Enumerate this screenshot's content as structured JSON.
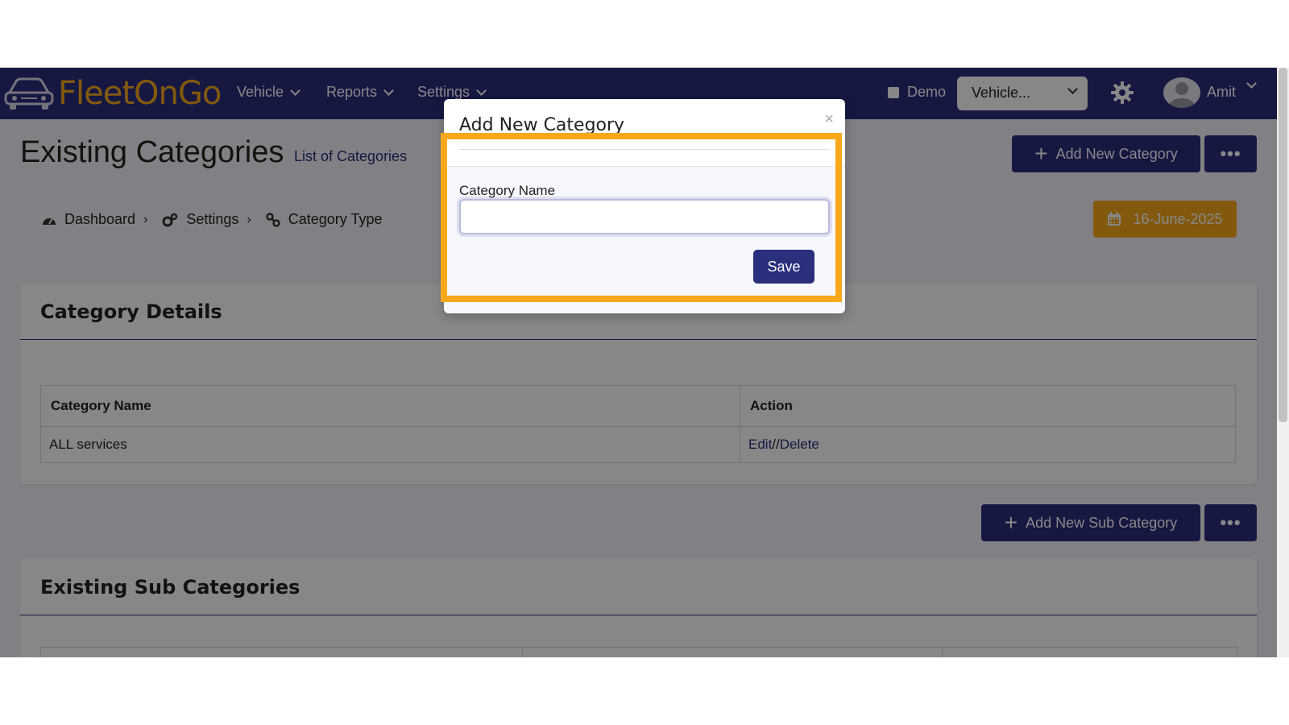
{
  "navbar": {
    "brand": "FleetOnGo",
    "brand_parts": [
      "Fleet",
      "On",
      "Go"
    ],
    "menu": [
      {
        "label": "Vehicle"
      },
      {
        "label": "Reports"
      },
      {
        "label": "Settings"
      }
    ],
    "demo_label": "Demo",
    "demo_checked": false,
    "vehicle_select": "Vehicle...",
    "user_name": "Amit"
  },
  "header": {
    "title": "Existing Categories",
    "subtitle": "List of Categories",
    "add_button": "Add New Category",
    "more_button": "•••"
  },
  "breadcrumb": {
    "items": [
      {
        "label": "Dashboard",
        "icon": "tachometer-icon"
      },
      {
        "label": "Settings",
        "icon": "cogs-icon"
      },
      {
        "label": "Category Type",
        "icon": "link-icon"
      }
    ],
    "separator": "›"
  },
  "date_button": "16-June-2025",
  "category_card": {
    "title": "Category Details",
    "columns": [
      "Category Name",
      "Action"
    ],
    "rows": [
      {
        "name": "ALL services",
        "edit": "Edit",
        "sep": "//",
        "delete": "Delete"
      }
    ]
  },
  "subcategory_toolbar": {
    "add_button": "Add New Sub Category",
    "more_button": "•••"
  },
  "subcategory_card": {
    "title": "Existing Sub Categories"
  },
  "modal": {
    "title": "Add New Category",
    "close": "×",
    "field_label": "Category Name",
    "field_value": "",
    "field_placeholder": "",
    "save_label": "Save"
  },
  "colors": {
    "primary": "#2a2f7e",
    "accent": "#f7a81b",
    "highlight": "#f7a81b"
  }
}
